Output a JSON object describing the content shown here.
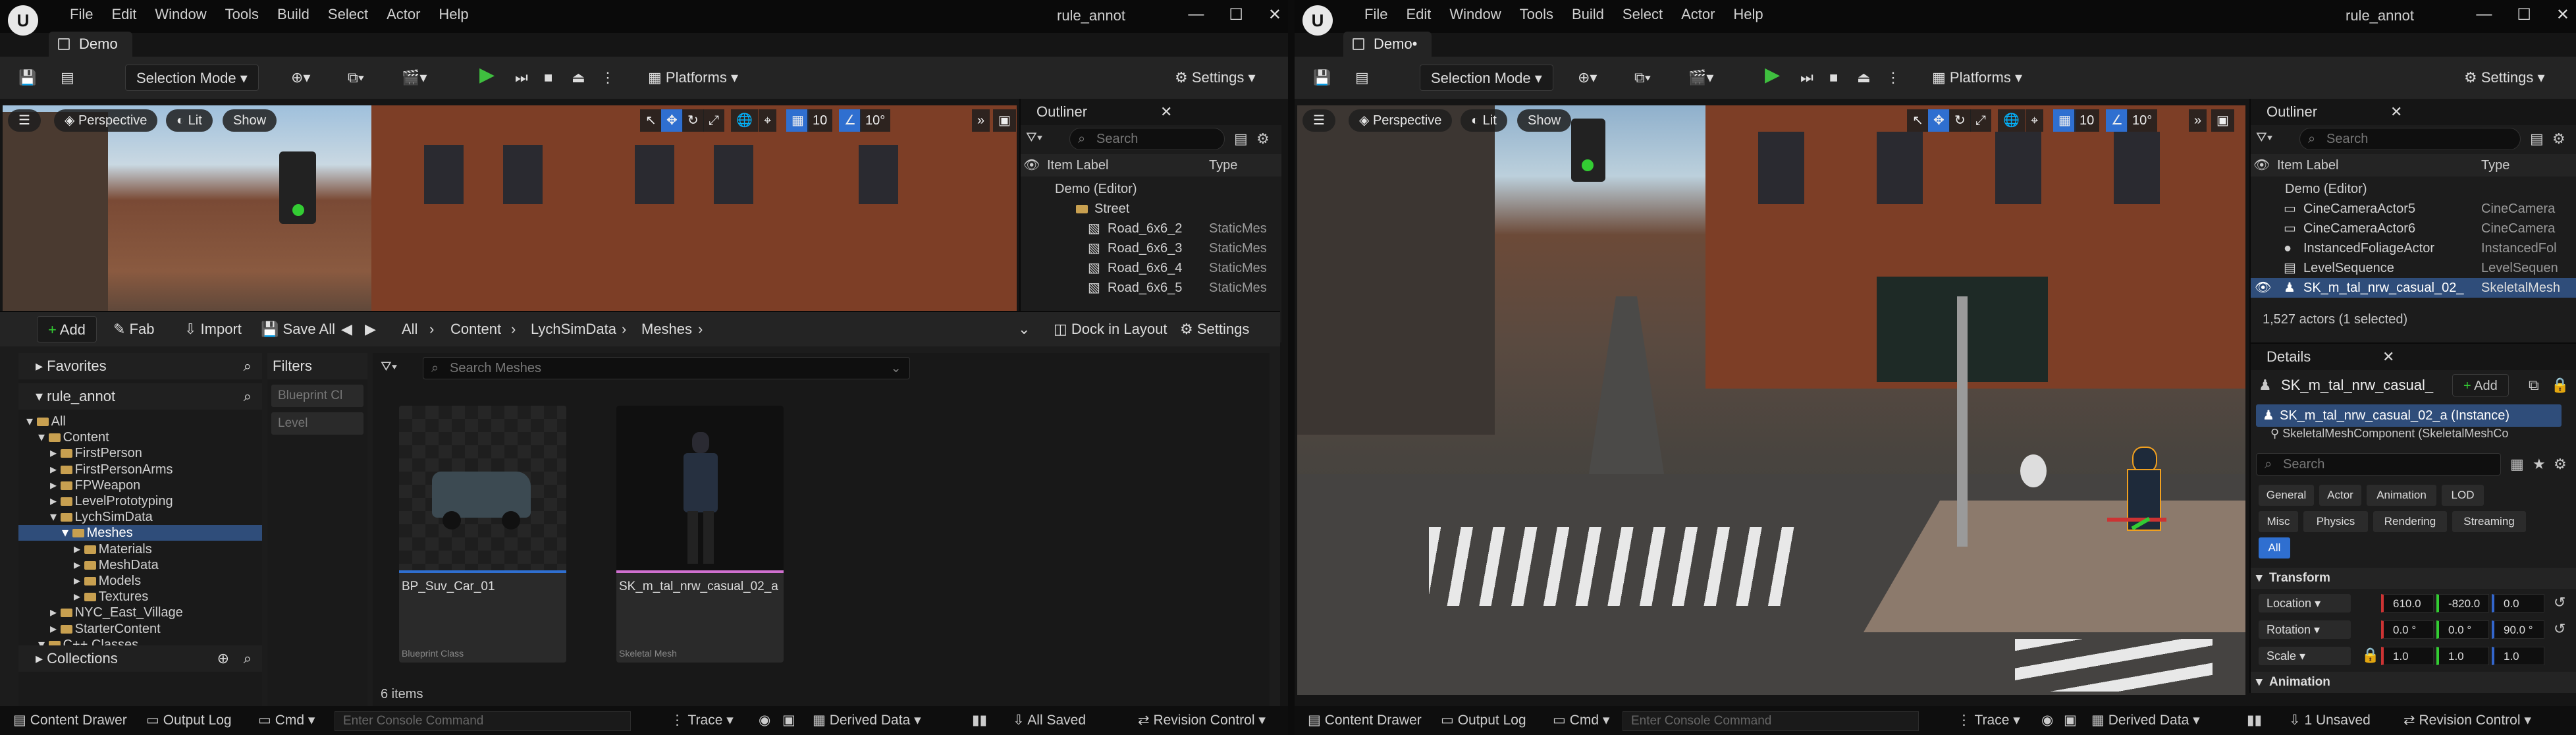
{
  "left": {
    "window_title": "rule_annot",
    "menu": [
      "File",
      "Edit",
      "Window",
      "Tools",
      "Build",
      "Select",
      "Actor",
      "Help"
    ],
    "tab": "Demo",
    "toolbar": {
      "mode": "Selection Mode",
      "platforms": "Platforms",
      "settings": "Settings"
    },
    "viewport": {
      "perspective": "Perspective",
      "lit": "Lit",
      "show": "Show",
      "grid": "10",
      "angle": "10°"
    },
    "outliner": {
      "title": "Outliner",
      "search_placeholder": "Search",
      "col_label": "Item Label",
      "col_type": "Type",
      "rows": [
        {
          "label": "Demo (Editor)",
          "type": ""
        },
        {
          "label": "Street",
          "type": ""
        },
        {
          "label": "Road_6x6_2",
          "type": "StaticMes"
        },
        {
          "label": "Road_6x6_3",
          "type": "StaticMes"
        },
        {
          "label": "Road_6x6_4",
          "type": "StaticMes"
        },
        {
          "label": "Road_6x6_5",
          "type": "StaticMes"
        }
      ]
    },
    "content": {
      "add": "Add",
      "fab": "Fab",
      "import": "Import",
      "save_all": "Save All",
      "breadcrumb": [
        "All",
        "Content",
        "LychSimData",
        "Meshes"
      ],
      "dock": "Dock in Layout",
      "settings": "Settings",
      "favorites": "Favorites",
      "project": "rule_annot",
      "tree": [
        {
          "label": "All",
          "depth": 0
        },
        {
          "label": "Content",
          "depth": 1
        },
        {
          "label": "FirstPerson",
          "depth": 2
        },
        {
          "label": "FirstPersonArms",
          "depth": 2
        },
        {
          "label": "FPWeapon",
          "depth": 2
        },
        {
          "label": "LevelPrototyping",
          "depth": 2
        },
        {
          "label": "LychSimData",
          "depth": 2
        },
        {
          "label": "Meshes",
          "depth": 3,
          "selected": true
        },
        {
          "label": "Materials",
          "depth": 4
        },
        {
          "label": "MeshData",
          "depth": 4
        },
        {
          "label": "Models",
          "depth": 4
        },
        {
          "label": "Textures",
          "depth": 4
        },
        {
          "label": "NYC_East_Village",
          "depth": 2
        },
        {
          "label": "StarterContent",
          "depth": 2
        },
        {
          "label": "C++ Classes",
          "depth": 1
        }
      ],
      "collections": "Collections",
      "filters_title": "Filters",
      "filter_chips": [
        "Blueprint Cl",
        "Level"
      ],
      "search_placeholder": "Search Meshes",
      "assets": [
        {
          "name": "BP_Suv_Car_01",
          "type": "Blueprint Class"
        },
        {
          "name": "SK_m_tal_nrw_casual_02_a",
          "type": "Skeletal Mesh"
        }
      ],
      "count": "6 items"
    },
    "status": {
      "drawer": "Content Drawer",
      "output": "Output Log",
      "cmd": "Cmd",
      "console_placeholder": "Enter Console Command",
      "trace": "Trace",
      "derived": "Derived Data",
      "saved": "All Saved",
      "revision": "Revision Control"
    }
  },
  "right": {
    "window_title": "rule_annot",
    "menu": [
      "File",
      "Edit",
      "Window",
      "Tools",
      "Build",
      "Select",
      "Actor",
      "Help"
    ],
    "tab": "Demo•",
    "toolbar": {
      "mode": "Selection Mode",
      "platforms": "Platforms",
      "settings": "Settings"
    },
    "viewport": {
      "perspective": "Perspective",
      "lit": "Lit",
      "show": "Show",
      "grid": "10",
      "angle": "10°"
    },
    "outliner": {
      "title": "Outliner",
      "search_placeholder": "Search",
      "col_label": "Item Label",
      "col_type": "Type",
      "rows": [
        {
          "label": "Demo (Editor)",
          "type": ""
        },
        {
          "label": "CineCameraActor5",
          "type": "CineCamera"
        },
        {
          "label": "CineCameraActor6",
          "type": "CineCamera"
        },
        {
          "label": "InstancedFoliageActor",
          "type": "InstancedFol"
        },
        {
          "label": "LevelSequence",
          "type": "LevelSequen"
        },
        {
          "label": "SK_m_tal_nrw_casual_02_",
          "type": "SkeletalMesh"
        }
      ],
      "summary": "1,527 actors (1 selected)"
    },
    "details": {
      "title": "Details",
      "actor": "SK_m_tal_nrw_casual_",
      "add": "Add",
      "instance": "SK_m_tal_nrw_casual_02_a (Instance)",
      "component": "SkeletalMeshComponent (SkeletalMeshCo",
      "search_placeholder": "Search",
      "categories": [
        "General",
        "Actor",
        "Animation",
        "LOD",
        "Misc",
        "Physics",
        "Rendering",
        "Streaming",
        "All"
      ],
      "transform": "Transform",
      "location": {
        "label": "Location",
        "x": "610.0",
        "y": "-820.0",
        "z": "0.0"
      },
      "rotation": {
        "label": "Rotation",
        "x": "0.0 °",
        "y": "0.0 °",
        "z": "90.0 °"
      },
      "scale": {
        "label": "Scale",
        "x": "1.0",
        "y": "1.0",
        "z": "1.0"
      },
      "animation": "Animation"
    },
    "status": {
      "drawer": "Content Drawer",
      "output": "Output Log",
      "cmd": "Cmd",
      "console_placeholder": "Enter Console Command",
      "trace": "Trace",
      "derived": "Derived Data",
      "saved": "1 Unsaved",
      "revision": "Revision Control"
    }
  }
}
